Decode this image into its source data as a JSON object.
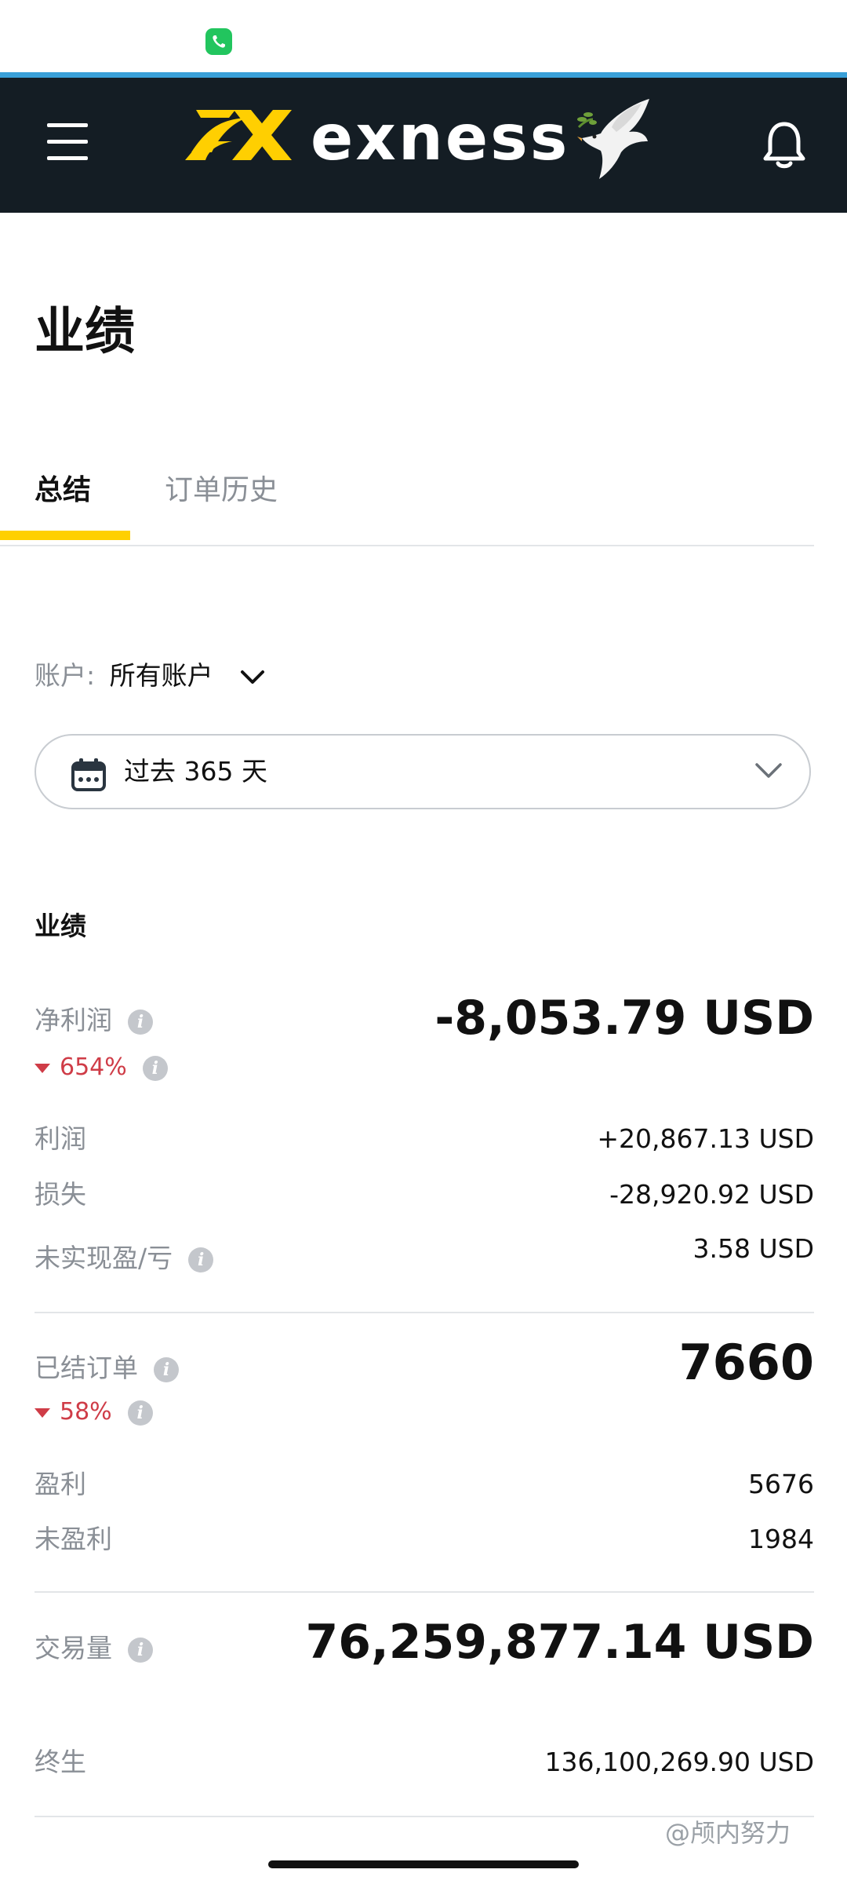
{
  "header": {
    "brand": "exness",
    "colors": {
      "header_bg": "#141d24",
      "logo_yellow": "#ffcf01",
      "accent_line": "#3aa0d8",
      "tab_underline": "#ffd000",
      "negative": "#cf3c47"
    }
  },
  "page": {
    "title": "业绩"
  },
  "tabs": [
    {
      "label": "总结",
      "active": true
    },
    {
      "label": "订单历史",
      "active": false
    }
  ],
  "filters": {
    "account_label": "账户:",
    "account_value": "所有账户",
    "period_value": "过去 365 天"
  },
  "performance": {
    "heading": "业绩",
    "net_profit": {
      "label": "净利润",
      "value": "-8,053.79 USD",
      "change": "654%"
    },
    "profit": {
      "label": "利润",
      "value": "+20,867.13 USD"
    },
    "loss": {
      "label": "损失",
      "value": "-28,920.92 USD"
    },
    "unrealized": {
      "label": "未实现盈/亏",
      "value": "3.58 USD"
    }
  },
  "orders": {
    "closed": {
      "label": "已结订单",
      "value": "7660",
      "change": "58%"
    },
    "profitable": {
      "label": "盈利",
      "value": "5676"
    },
    "unprofitable": {
      "label": "未盈利",
      "value": "1984"
    }
  },
  "volume": {
    "label": "交易量",
    "value": "76,259,877.14 USD",
    "lifetime": {
      "label": "终生",
      "value": "136,100,269.90 USD"
    }
  },
  "watermark": "@颅内努力"
}
